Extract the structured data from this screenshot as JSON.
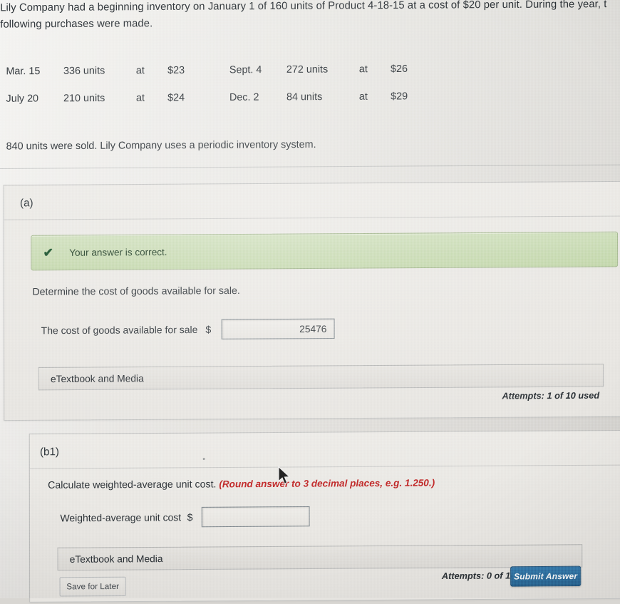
{
  "problem": {
    "line1": "Lily Company had a beginning inventory on January 1 of 160 units of Product 4-18-15 at a cost of $20 per unit. During the year, t",
    "line2": "following purchases were made.",
    "sold_line": "840 units were sold. Lily Company uses a periodic inventory system."
  },
  "purchases": {
    "rows": [
      {
        "date1": "Mar. 15",
        "units1": "336 units",
        "at1": "at",
        "price1": "$23",
        "date2": "Sept. 4",
        "units2": "272 units",
        "at2": "at",
        "price2": "$26"
      },
      {
        "date1": "July 20",
        "units1": "210 units",
        "at1": "at",
        "price1": "$24",
        "date2": "Dec. 2",
        "units2": "84 units",
        "at2": "at",
        "price2": "$29"
      }
    ]
  },
  "section_a": {
    "label": "(a)",
    "banner": {
      "icon": "check-icon",
      "text": "Your answer is correct."
    },
    "question": "Determine the cost of goods available for sale.",
    "answer_label": "The cost of goods available for sale",
    "currency": "$",
    "answer_value": "25476",
    "etextbook_label": "eTextbook and Media",
    "attempts": "Attempts: 1 of 10 used"
  },
  "section_b1": {
    "label": "(b1)",
    "question": "Calculate weighted-average unit cost.",
    "hint": "(Round answer to 3 decimal places, e.g. 1.250.)",
    "answer_label": "Weighted-average unit cost",
    "currency": "$",
    "answer_value": "",
    "answer_placeholder": "",
    "etextbook_label": "eTextbook and Media",
    "attempts": "Attempts: 0 of 10 used",
    "save_label": "Save for Later",
    "submit_label": "Submit Answer"
  },
  "colors": {
    "banner_bg": "#c9ddb4",
    "banner_border": "#9fb488",
    "hint_red": "#c02626",
    "submit_blue": "#2a6694",
    "page_bg": "#e6e4e0"
  }
}
